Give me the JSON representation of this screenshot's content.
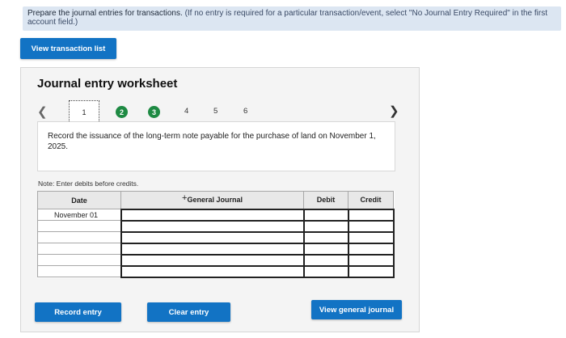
{
  "instructions": {
    "main": "Prepare the journal entries for transactions.",
    "paren": "(If no entry is required for a particular transaction/event, select \"No Journal Entry Required\" in the first account field.)"
  },
  "buttons": {
    "view_transactions": "View transaction list",
    "record": "Record entry",
    "clear": "Clear entry",
    "view_journal": "View general journal"
  },
  "worksheet": {
    "title": "Journal entry worksheet",
    "pager": {
      "current": "1",
      "done": [
        "2",
        "3"
      ],
      "pending": [
        "4",
        "5",
        "6"
      ]
    },
    "prompt": "Record the issuance of the long-term note payable for the purchase of land on November 1, 2025.",
    "note": "Note: Enter debits before credits."
  },
  "journal_table": {
    "headers": {
      "date": "Date",
      "account": "General Journal",
      "debit": "Debit",
      "credit": "Credit"
    },
    "rows": [
      {
        "date": "November 01",
        "account": "",
        "debit": "",
        "credit": ""
      },
      {
        "date": "",
        "account": "",
        "debit": "",
        "credit": ""
      },
      {
        "date": "",
        "account": "",
        "debit": "",
        "credit": ""
      },
      {
        "date": "",
        "account": "",
        "debit": "",
        "credit": ""
      },
      {
        "date": "",
        "account": "",
        "debit": "",
        "credit": ""
      },
      {
        "date": "",
        "account": "",
        "debit": "",
        "credit": ""
      }
    ]
  },
  "colors": {
    "accent_blue": "#1273c4",
    "done_green": "#1e8a43",
    "instruction_bg": "#dce6f2"
  }
}
